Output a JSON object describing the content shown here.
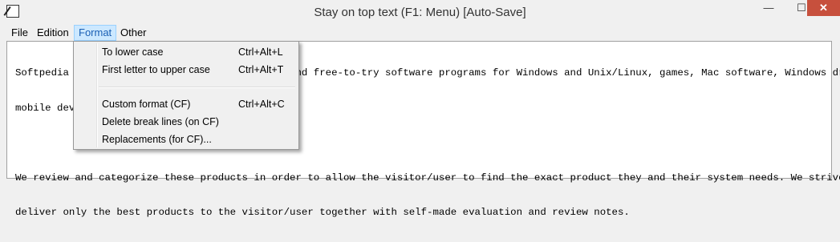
{
  "window": {
    "title": "Stay on top text (F1: Menu) [Auto-Save]",
    "minimize_glyph": "—",
    "maximize_glyph": "☐",
    "close_glyph": "✕"
  },
  "menubar": {
    "items": [
      "File",
      "Edition",
      "Format",
      "Other"
    ],
    "active": "Format"
  },
  "format_menu": {
    "items": [
      {
        "label": "To lower case",
        "shortcut": "Ctrl+Alt+L"
      },
      {
        "label": "First letter to upper case",
        "shortcut": "Ctrl+Alt+T"
      },
      {
        "label": "Custom format (CF)",
        "shortcut": "Ctrl+Alt+C"
      },
      {
        "label": "Delete break lines (on CF)",
        "shortcut": ""
      },
      {
        "label": "Replacements (for CF)...",
        "shortcut": ""
      }
    ]
  },
  "editor": {
    "line1": "Softpedia is a library of over 1,300,000 free and free-to-try software programs for Windows and Unix/Linux, games, Mac software, Windows drivers,",
    "line2": "mobile devices and IT-related articles.",
    "line3": "",
    "line4": "We review and categorize these products in order to allow the visitor/user to find the exact product they and their system needs. We strive to",
    "line5": "deliver only the best products to the visitor/user together with self-made evaluation and review notes."
  },
  "icons": {
    "app": "notepad-pen-icon"
  }
}
